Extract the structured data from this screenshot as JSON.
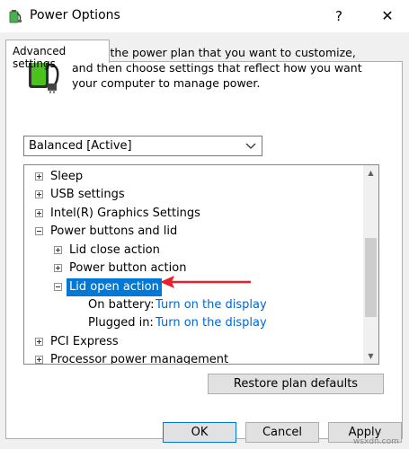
{
  "window": {
    "title": "Power Options",
    "help_label": "?",
    "close_label": "✕",
    "icon": "power-options-icon"
  },
  "tab": {
    "label": "Advanced settings"
  },
  "description": "Select the power plan that you want to customize, and then choose settings that reflect how you want your computer to manage power.",
  "plan_select": {
    "value": "Balanced [Active]",
    "icon": "chevron-down-icon"
  },
  "tree": {
    "items": [
      {
        "label": "Sleep",
        "level": 0,
        "state": "collapsed"
      },
      {
        "label": "USB settings",
        "level": 0,
        "state": "collapsed"
      },
      {
        "label": "Intel(R) Graphics Settings",
        "level": 0,
        "state": "collapsed"
      },
      {
        "label": "Power buttons and lid",
        "level": 0,
        "state": "expanded"
      },
      {
        "label": "Lid close action",
        "level": 1,
        "state": "collapsed"
      },
      {
        "label": "Power button action",
        "level": 1,
        "state": "collapsed"
      },
      {
        "label": "Lid open action",
        "level": 1,
        "state": "expanded",
        "selected": true
      },
      {
        "label": "On battery:",
        "value": "Turn on the display",
        "level": 2
      },
      {
        "label": "Plugged in:",
        "value": "Turn on the display",
        "level": 2
      },
      {
        "label": "PCI Express",
        "level": 0,
        "state": "collapsed"
      },
      {
        "label": "Processor power management",
        "level": 0,
        "state": "collapsed"
      }
    ],
    "scroll_position": 0.45
  },
  "buttons": {
    "restore": "Restore plan defaults",
    "ok": "OK",
    "cancel": "Cancel",
    "apply": "Apply"
  },
  "watermark": "wsxdn.com",
  "colors": {
    "selection": "#0078d7",
    "link": "#0066cc",
    "annotation_arrow": "#e8202a",
    "dialog_bg": "#f0f0f0"
  }
}
